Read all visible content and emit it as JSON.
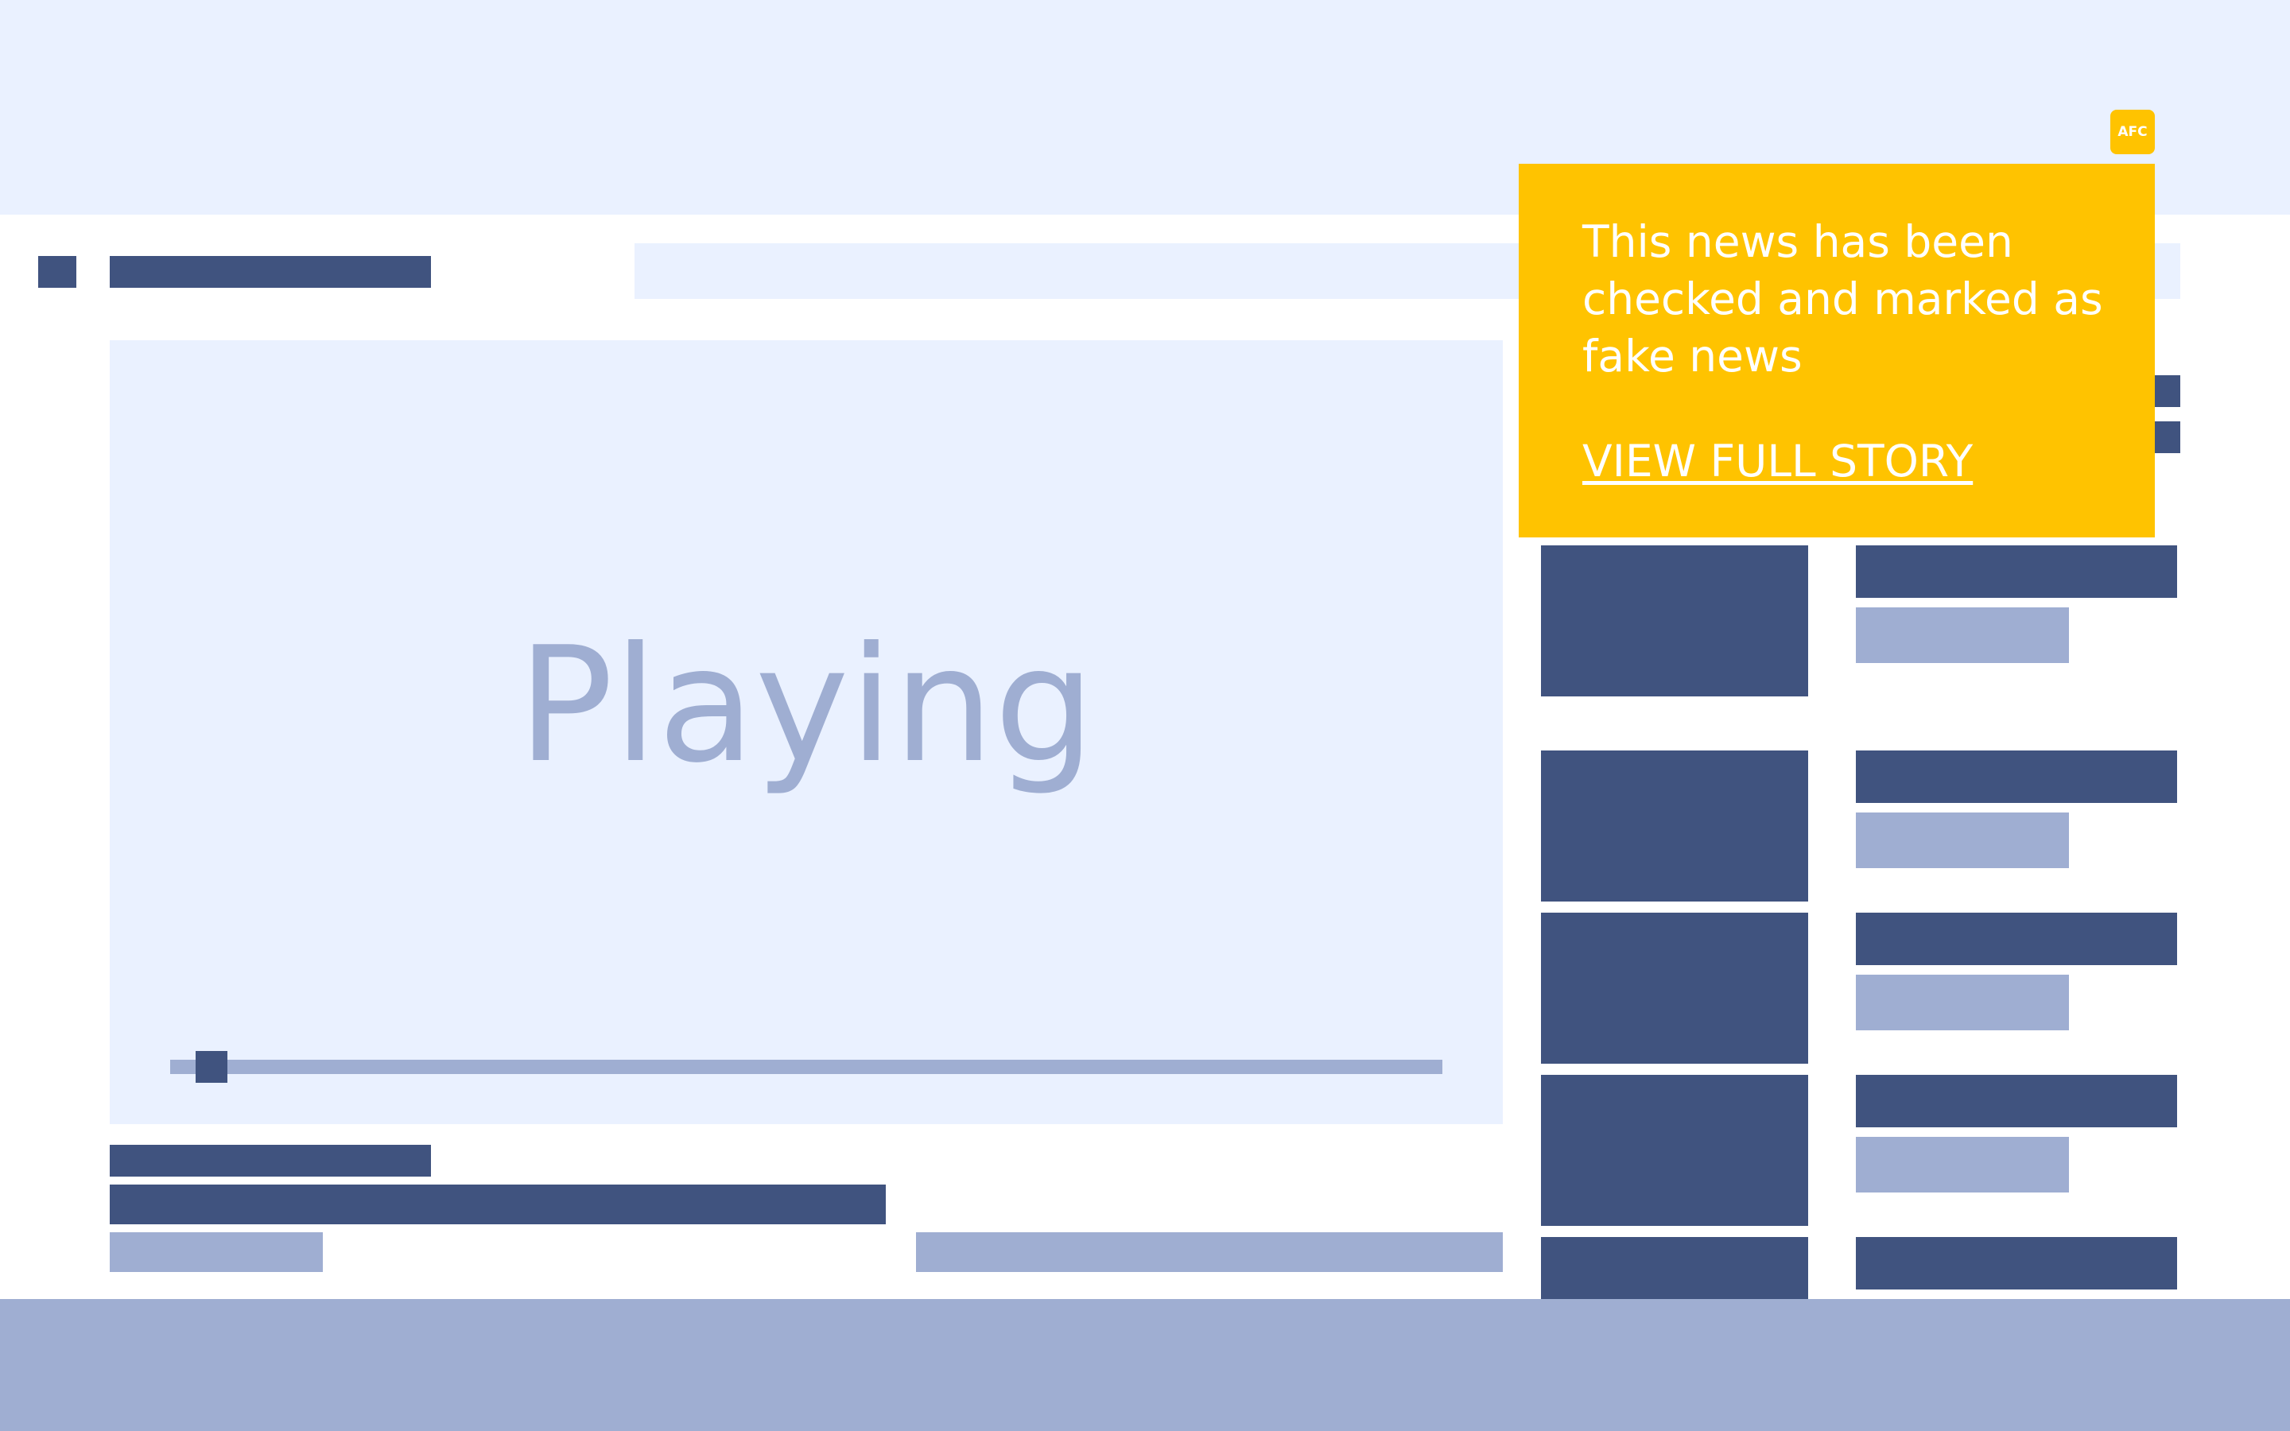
{
  "player": {
    "status_label": "Playing",
    "progress": 0.02
  },
  "fact_check": {
    "badge_label": "AFC",
    "message": "This news has been checked and marked as fake news",
    "link_label": "VIEW FULL STORY"
  },
  "colors": {
    "accent": "#ffc300",
    "placeholder_dark": "#40537f",
    "placeholder_mid": "#9faed2",
    "background_light": "#eaf1ff"
  }
}
